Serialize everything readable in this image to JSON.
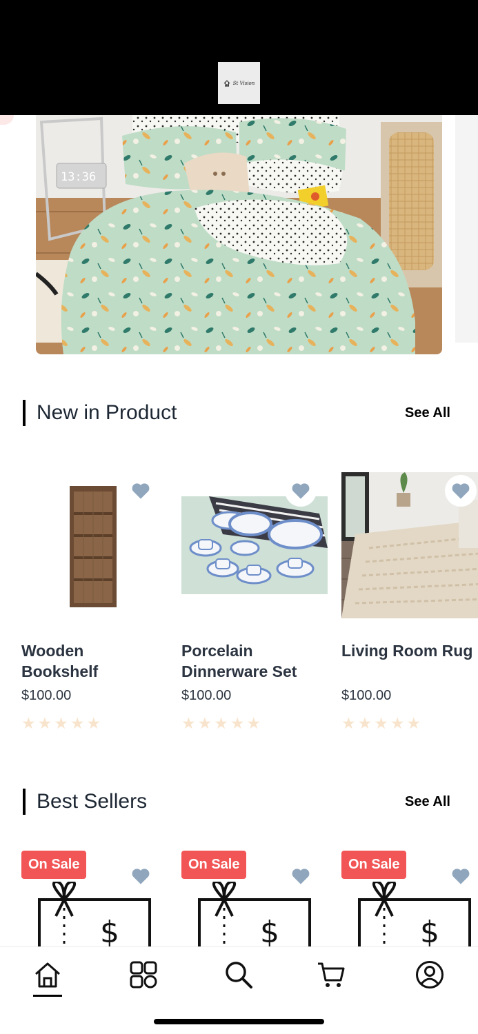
{
  "header": {
    "logo_text": "St Vision"
  },
  "sections": {
    "new_in": {
      "title": "New in Product",
      "see_all": "See All",
      "products": [
        {
          "name": "Wooden\nBookshelf",
          "price": "$100.00",
          "rating": 0
        },
        {
          "name": "Porcelain\nDinnerware Set",
          "price": "$100.00",
          "rating": 0
        },
        {
          "name": "Living Room Rug",
          "price": "$100.00",
          "rating": 0
        }
      ]
    },
    "best_sellers": {
      "title": "Best Sellers",
      "see_all": "See All",
      "badge": "On Sale"
    }
  },
  "tabs": [
    {
      "icon": "home-icon",
      "active": true
    },
    {
      "icon": "grid-icon",
      "active": false
    },
    {
      "icon": "search-icon",
      "active": false
    },
    {
      "icon": "cart-icon",
      "active": false
    },
    {
      "icon": "profile-icon",
      "active": false
    }
  ],
  "colors": {
    "heart": "#8fa6bd",
    "star_empty": "#f8e4cc",
    "sale_badge": "#f25555",
    "topbar": "#000000"
  }
}
